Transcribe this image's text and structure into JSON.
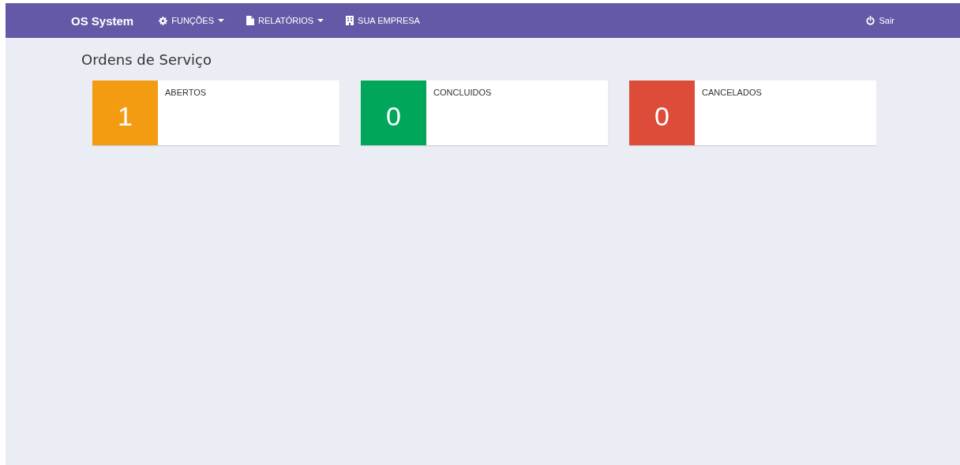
{
  "navbar": {
    "brand": "OS System",
    "menu": [
      {
        "label": "FUNÇÕES",
        "kind": "gear",
        "dropdown": true
      },
      {
        "label": "RELATÓRIOS",
        "kind": "file",
        "dropdown": true
      },
      {
        "label": "SUA EMPRESA",
        "kind": "building",
        "dropdown": false
      }
    ],
    "right_menu": [
      {
        "label": "Sair",
        "kind": "power",
        "dropdown": false
      }
    ]
  },
  "page_title": "Ordens de Serviço",
  "info_boxes": [
    {
      "label": "ABERTOS",
      "count": "1",
      "color": "#f39c12"
    },
    {
      "label": "CONCLUIDOS",
      "count": "0",
      "color": "#00a65a"
    },
    {
      "label": "CANCELADOS",
      "count": "0",
      "color": "#dd4b39"
    }
  ]
}
